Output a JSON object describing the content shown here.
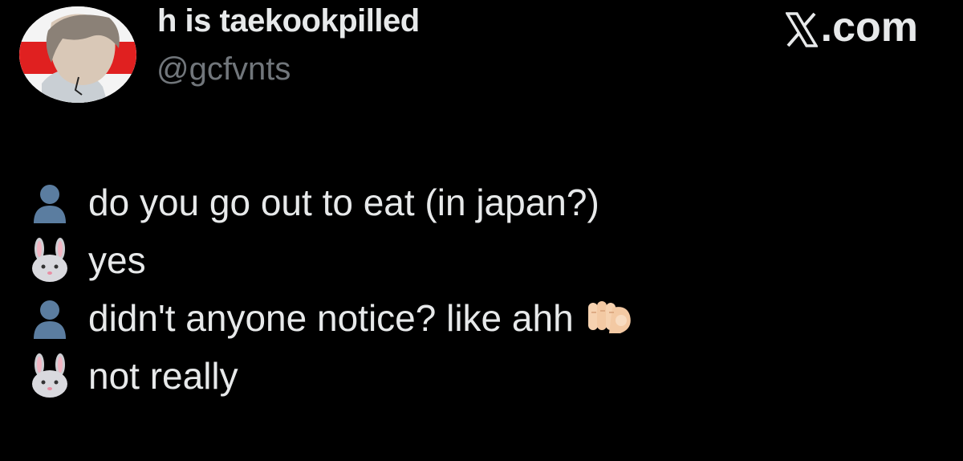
{
  "post": {
    "author": {
      "display_name": "h is taekookpilled",
      "handle": "@gcfvnts"
    },
    "brand": {
      "label": ".com",
      "icon": "x-logo-icon"
    },
    "lines": [
      {
        "speaker_icon": "person-silhouette-icon",
        "text": "do you go out to eat (in japan?)"
      },
      {
        "speaker_icon": "rabbit-face-icon",
        "text": "yes"
      },
      {
        "speaker_icon": "person-silhouette-icon",
        "text": "didn't anyone notice? like ahh",
        "trailing_icon": "pointing-finger-icon"
      },
      {
        "speaker_icon": "rabbit-face-icon",
        "text": "not really"
      }
    ]
  },
  "colors": {
    "background": "#000000",
    "primary_text": "#e7e9ea",
    "secondary_text": "#71767b",
    "person_icon": "#5b7da0",
    "rabbit_icon": "#cfcfd4"
  }
}
